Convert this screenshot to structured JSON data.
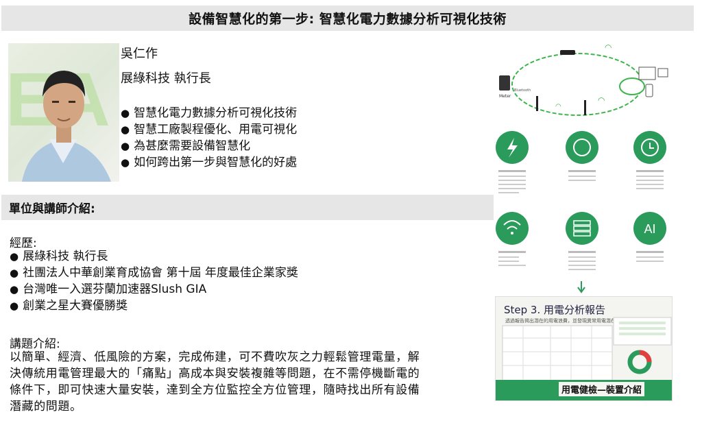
{
  "header": {
    "title": "設備智慧化的第一步: 智慧化電力數據分析可視化技術"
  },
  "speaker": {
    "name": "吳仁作",
    "company_title": "展綠科技 執行長",
    "photo_logo": "EA"
  },
  "topics": [
    "智慧化電力數據分析可視化技術",
    "智慧工廠製程優化、用電可視化",
    "為甚麼需要設備智慧化",
    "如何跨出第一步與智慧化的好處"
  ],
  "section": {
    "title": "單位與講師介紹:"
  },
  "experience": {
    "heading": "經歷:",
    "items": [
      "展綠科技 執行長",
      "社團法人中華創業育成協會 第十屆 年度最佳企業家獎",
      "台灣唯一入選芬蘭加速器Slush GIA",
      "創業之星大賽優勝獎"
    ]
  },
  "talk": {
    "heading": "講題介紹:",
    "lines": [
      "以簡單、經濟、低風險的方案，完成佈建，可不費吹灰之力輕鬆管理電量，解",
      "決傳統用電管理最大的「痛點」高成本與安裝複雜等問題，在不需停機斷電的",
      "條件下，即可快速大量安裝，達到全方位監控全方位管理，隨時找出所有設備",
      "潛藏的問題。"
    ]
  },
  "diagram": {
    "labels": {
      "meter": "Meter",
      "bluetooth": "Bluetooth",
      "wifi": "Wi-Fi",
      "ai": "AI"
    },
    "icon_names": [
      "lightning-icon",
      "meter-icon",
      "clock-icon",
      "wifi-icon",
      "server-icon",
      "ai-icon"
    ],
    "accent": "#2a9b5a"
  },
  "report": {
    "title": "Step 3. 用電分析報告",
    "subtitle": "透過報告揭出潛在的用電浪費，並發現異常用電潛在風險",
    "footer": "用電健檢—裝置介紹"
  },
  "colors": {
    "bar_bg": "#e6e6e6",
    "green": "#2a9b5a"
  }
}
